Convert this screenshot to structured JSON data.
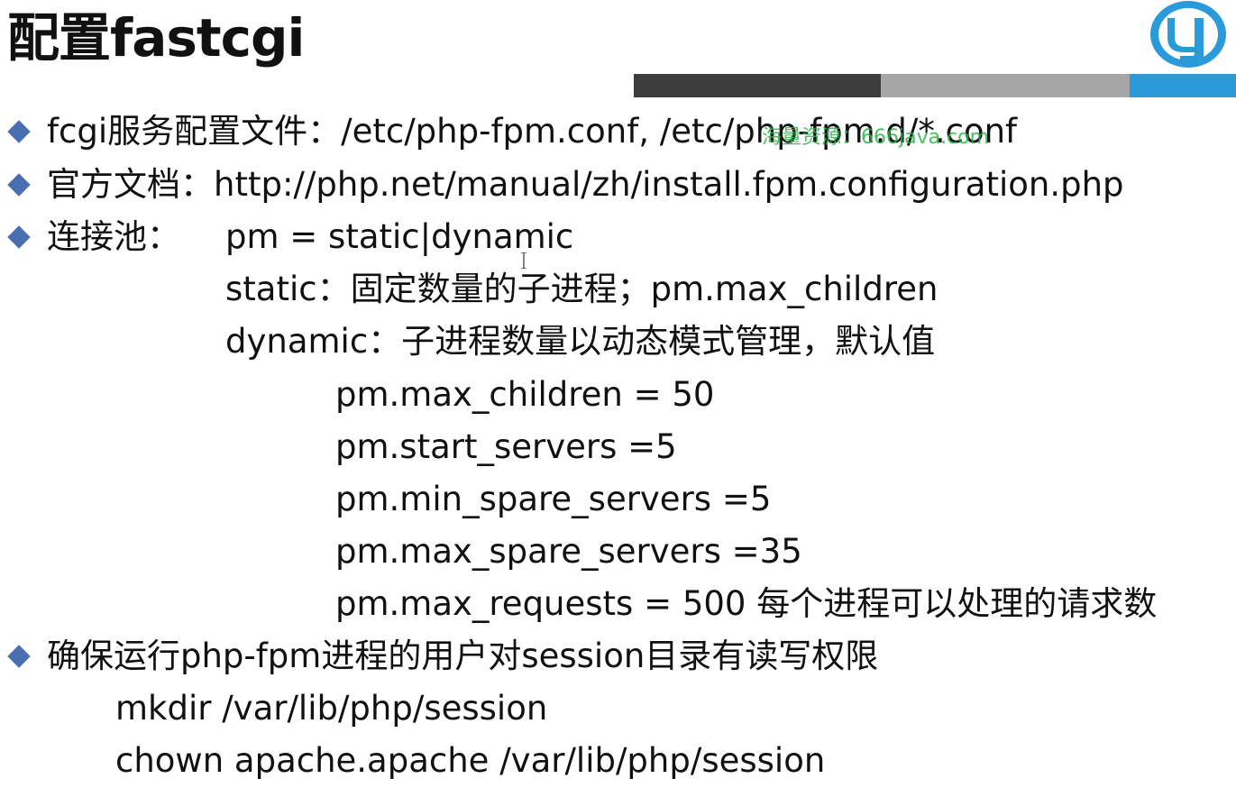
{
  "title": "配置fastcgi",
  "logo_icon": "brand-logo-icon",
  "colors": {
    "accent_blue": "#2a9bd8",
    "bullet": "#4a6fb0",
    "watermark": "#2bb34a"
  },
  "watermark": "海量资源：666java.com",
  "lines": {
    "config_file": "fcgi服务配置文件：/etc/php-fpm.conf,  /etc/php-fpm.d/*.conf",
    "official_doc": "官方文档：http://php.net/manual/zh/install.fpm.configuration.php",
    "pool_label": "连接池：",
    "pool_pm": "pm = static|dynamic",
    "static_desc": "static：固定数量的子进程；pm.max_children",
    "dynamic_desc": "dynamic：子进程数量以动态模式管理，默认值",
    "max_children": "pm.max_children = 50",
    "start_servers": "pm.start_servers =5",
    "min_spare": "pm.min_spare_servers =5",
    "max_spare": "pm.max_spare_servers =35",
    "max_requests": "pm.max_requests = 500  每个进程可以处理的请求数",
    "session_perm": "确保运行php-fpm进程的用户对session目录有读写权限",
    "mkdir_cmd": "mkdir  /var/lib/php/session",
    "chown_cmd": "chown apache.apache /var/lib/php/session"
  }
}
